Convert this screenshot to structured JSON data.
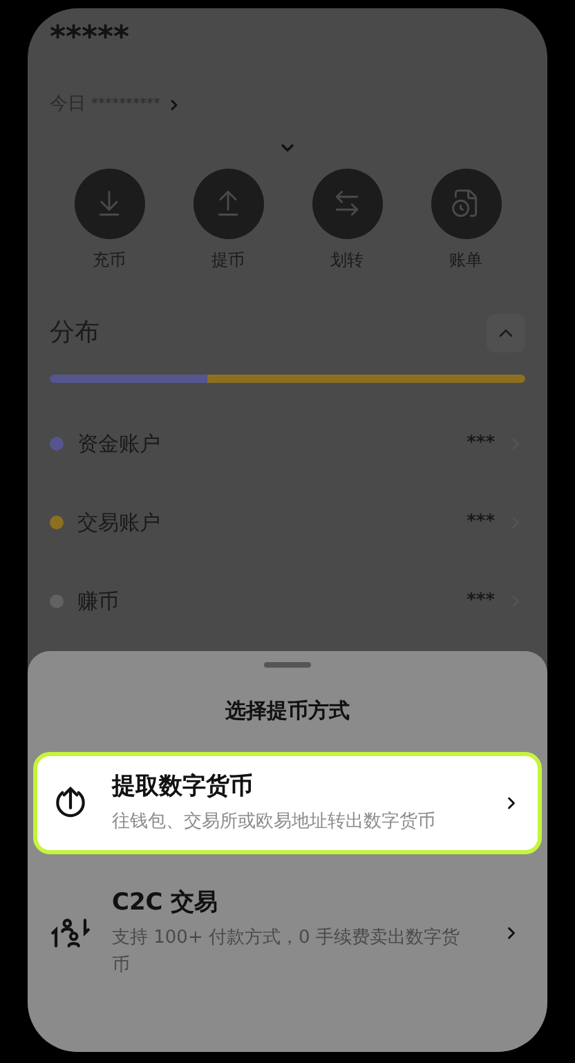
{
  "balance": "*****",
  "today": {
    "label": "今日",
    "value": "**********"
  },
  "actions": [
    {
      "kind": "deposit",
      "label": "充币"
    },
    {
      "kind": "withdraw",
      "label": "提币"
    },
    {
      "kind": "transfer",
      "label": "划转"
    },
    {
      "kind": "bill",
      "label": "账单"
    }
  ],
  "distribution": {
    "title": "分布",
    "expanded": true,
    "segments": [
      {
        "color": "#555590",
        "level": 0.33
      },
      {
        "color": "#8c7020",
        "level": 0.67
      }
    ],
    "accounts": [
      {
        "name": "资金账户",
        "value": "***",
        "color": "#555590"
      },
      {
        "name": "交易账户",
        "value": "***",
        "color": "#8c7020"
      },
      {
        "name": "赚币",
        "value": "***",
        "color": "#626262"
      }
    ]
  },
  "sheet": {
    "title": "选择提币方式",
    "options": [
      {
        "kind": "withdraw",
        "title": "提取数字货币",
        "description": "往钱包、交易所或欧易地址转出数字货币",
        "selected": true
      },
      {
        "kind": "c2c",
        "title": "C2C 交易",
        "description": "支持 100+ 付款方式，0 手续费卖出数字货币",
        "selected": false
      }
    ]
  }
}
